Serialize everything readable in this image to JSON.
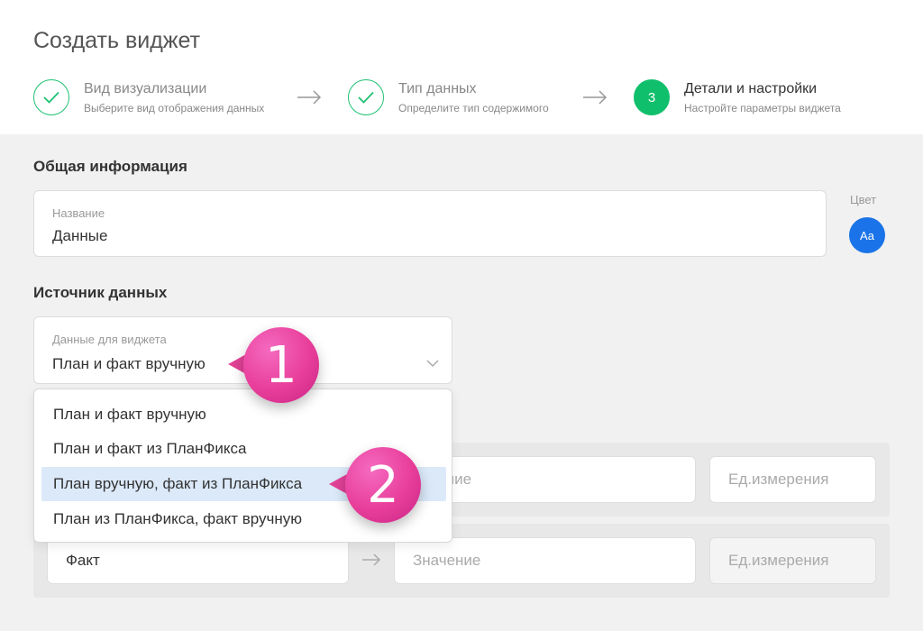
{
  "page": {
    "title": "Создать виджет"
  },
  "steps": [
    {
      "title": "Вид визуализации",
      "subtitle": "Выберите вид отображения данных",
      "state": "done",
      "icon": "check-icon"
    },
    {
      "title": "Тип данных",
      "subtitle": "Определите тип содержимого",
      "state": "done",
      "icon": "check-icon"
    },
    {
      "number": "3",
      "title": "Детали и настройки",
      "subtitle": "Настройте параметры виджета",
      "state": "active"
    }
  ],
  "general": {
    "section_title": "Общая информация",
    "name_label": "Название",
    "name_value": "Данные",
    "color_label": "Цвет",
    "color_swatch_text": "Aa",
    "color_value": "#1a73e8"
  },
  "source": {
    "section_title": "Источник данных",
    "select_label": "Данные для виджета",
    "select_value": "План и факт вручную",
    "options": [
      "План и факт вручную",
      "План и факт из ПланФикса",
      "План вручную, факт из ПланФикса",
      "План из ПланФикса, факт вручную"
    ],
    "highlighted_option_index": 2
  },
  "rows": [
    {
      "value_placeholder_visible": "начение",
      "unit_placeholder": "Ед.измерения"
    },
    {
      "name": "Факт",
      "value_placeholder": "Значение",
      "unit_placeholder": "Ед.измерения"
    }
  ],
  "callouts": [
    "1",
    "2"
  ],
  "colors": {
    "accent_green": "#10bf6b",
    "callout_pink": "#e83e9a",
    "selected_option": "#dbe9f9"
  }
}
